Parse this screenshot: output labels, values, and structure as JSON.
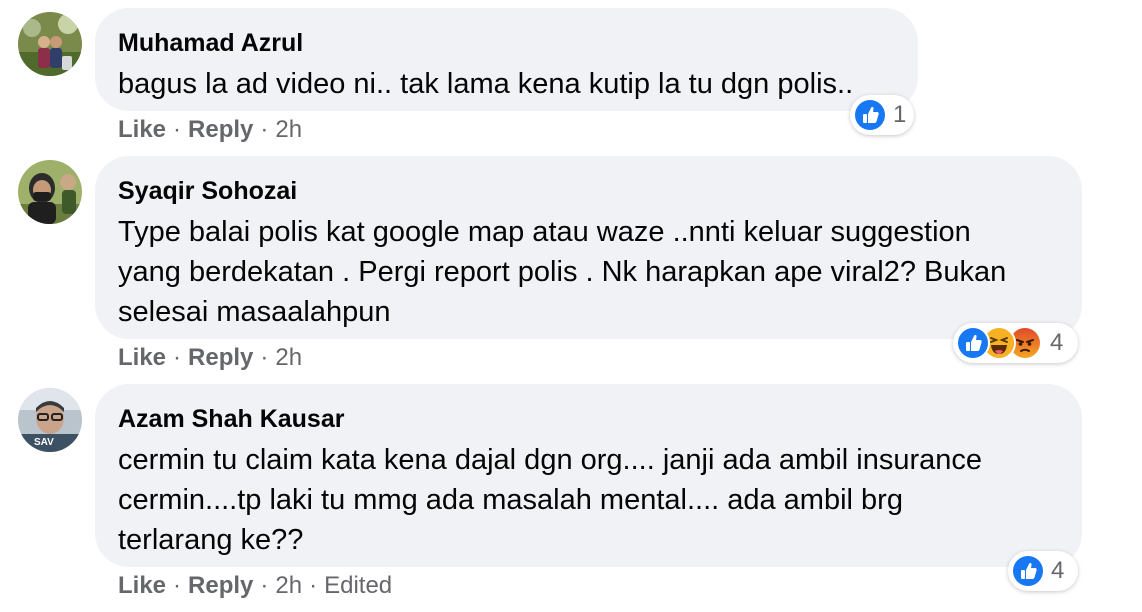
{
  "comments": [
    {
      "author": "Muhamad Azrul",
      "text": "bagus la ad video ni.. tak lama kena kutip la tu dgn polis..",
      "actions": {
        "like": "Like",
        "reply": "Reply",
        "time": "2h",
        "edited": ""
      },
      "reactions": {
        "icons": [
          "like-icon"
        ],
        "count": "1"
      }
    },
    {
      "author": "Syaqir Sohozai",
      "text": "Type balai polis kat google map atau waze ..nnti keluar suggestion\nyang berdekatan . Pergi report polis . Nk harapkan ape viral2? Bukan\nselesai masaalahpun",
      "actions": {
        "like": "Like",
        "reply": "Reply",
        "time": "2h",
        "edited": ""
      },
      "reactions": {
        "icons": [
          "like-icon",
          "haha-icon",
          "angry-icon"
        ],
        "count": "4"
      }
    },
    {
      "author": "Azam Shah Kausar",
      "text": "cermin tu claim kata kena dajal dgn org.... janji ada ambil insurance\ncermin....tp laki tu mmg ada masalah mental.... ada ambil brg\nterlarang ke??",
      "actions": {
        "like": "Like",
        "reply": "Reply",
        "time": "2h",
        "edited": "Edited"
      },
      "reactions": {
        "icons": [
          "like-icon"
        ],
        "count": "4"
      }
    }
  ],
  "avatar_text": {
    "azam": "SAV"
  },
  "colors": {
    "bubble": "#f0f2f5",
    "text": "#050505",
    "meta": "#65676b",
    "like_blue": "#1877f2",
    "angry_orange": "#e9710f",
    "haha_yellow": "#f7b125"
  }
}
